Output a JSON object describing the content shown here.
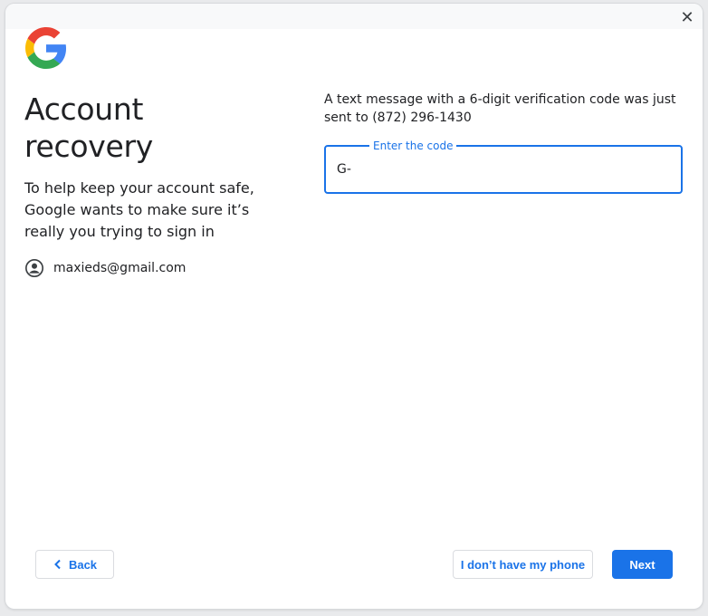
{
  "window": {
    "close_icon": "close-icon"
  },
  "brand": {
    "logo": "google-g-logo",
    "colors": {
      "blue": "#4285F4",
      "red": "#EA4335",
      "yellow": "#FBBC05",
      "green": "#34A853"
    }
  },
  "left": {
    "title": "Account recovery",
    "subtitle": "To help keep your account safe, Google wants to make sure it’s really you trying to sign in",
    "account_icon": "account-circle-icon",
    "email": "maxieds@gmail.com"
  },
  "right": {
    "message": "A text message with a 6-digit verification code was just sent to (872) 296-1430",
    "code_field": {
      "label": "Enter the code",
      "value": "G-"
    }
  },
  "footer": {
    "back_label": "Back",
    "no_phone_label": "I don’t have my phone",
    "next_label": "Next"
  },
  "accent": "#1a73e8"
}
